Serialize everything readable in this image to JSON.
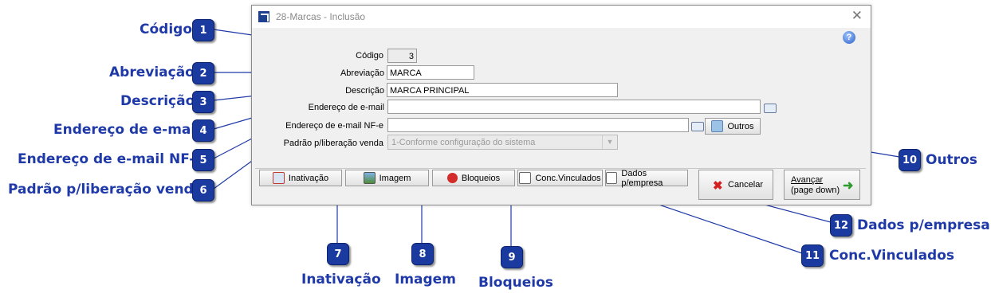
{
  "window": {
    "title": "28-Marcas - Inclusão",
    "close_glyph": "✕",
    "help_glyph": "?"
  },
  "form": {
    "codigo": {
      "label": "Código",
      "value": "3"
    },
    "abreviacao": {
      "label": "Abreviação",
      "value": "MARCA"
    },
    "descricao": {
      "label": "Descrição",
      "value": "MARCA PRINCIPAL"
    },
    "email": {
      "label": "Endereço de e-mail",
      "value": ""
    },
    "email_nfe": {
      "label": "Endereço de e-mail NF-e",
      "value": ""
    },
    "padrao": {
      "label": "Padrão p/liberação venda",
      "value": "1-Conforme configuração do sistema"
    }
  },
  "buttons": {
    "outros": "Outros",
    "inativacao": "Inativação",
    "imagem": "Imagem",
    "bloqueios": "Bloqueios",
    "conc_vinculados": "Conc.Vinculados",
    "dados_empresa": "Dados p/empresa",
    "cancelar": "Cancelar",
    "avancar_line1": "Avançar",
    "avancar_line2": "(page down)"
  },
  "callouts": [
    {
      "num": "1",
      "label": "Código"
    },
    {
      "num": "2",
      "label": "Abreviação"
    },
    {
      "num": "3",
      "label": "Descrição"
    },
    {
      "num": "4",
      "label": "Endereço de e-mail"
    },
    {
      "num": "5",
      "label": "Endereço de e-mail NF-e"
    },
    {
      "num": "6",
      "label": "Padrão p/liberação venda"
    },
    {
      "num": "7",
      "label": "Inativação"
    },
    {
      "num": "8",
      "label": "Imagem"
    },
    {
      "num": "9",
      "label": "Bloqueios"
    },
    {
      "num": "10",
      "label": "Outros"
    },
    {
      "num": "11",
      "label": "Conc.Vinculados"
    },
    {
      "num": "12",
      "label": "Dados p/empresa"
    }
  ],
  "colors": {
    "callout_text": "#1f3aa8",
    "badge_fill": "#1a3aa0",
    "leader_line": "#1f3aa8"
  },
  "icons": {
    "app": "app-icon",
    "help": "help-icon",
    "mail": "mail-icon",
    "inativacao": "inactivate-icon",
    "imagem": "image-icon",
    "bloqueios": "block-icon",
    "conc_vinculados": "edit-icon",
    "dados_empresa": "edit-icon",
    "cancelar": "red-x-icon",
    "avancar": "green-arrow-icon"
  }
}
